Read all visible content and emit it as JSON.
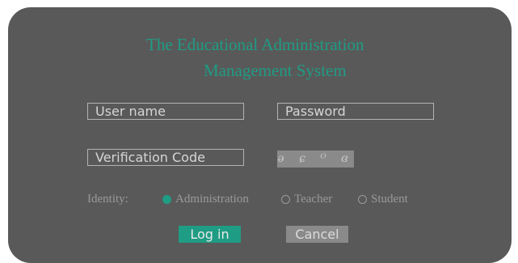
{
  "title_line1": "The Educational Administration",
  "title_line2": "Management System",
  "fields": {
    "username_placeholder": "User name",
    "password_placeholder": "Password",
    "verification_placeholder": "Verification Code"
  },
  "captcha_text": "ə ɕ ᴼ ɞ",
  "identity": {
    "label": "Identity:",
    "options": [
      "Administration",
      "Teacher",
      "Student"
    ],
    "selected": "Administration"
  },
  "buttons": {
    "login": "Log in",
    "cancel": "Cancel"
  },
  "colors": {
    "accent": "#1f9c84",
    "panel": "#595959",
    "muted_button": "#8a8a8a"
  }
}
